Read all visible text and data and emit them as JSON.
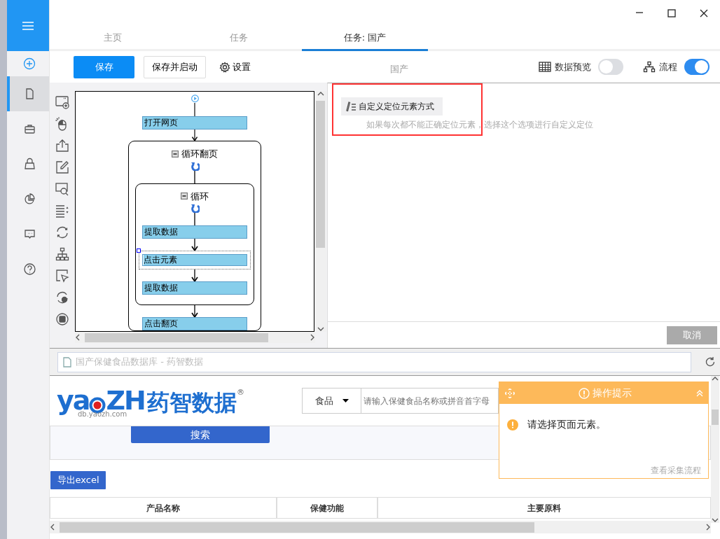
{
  "sidebar": {
    "items": [
      {
        "kind": "add",
        "selected": false
      },
      {
        "kind": "document",
        "selected": true
      },
      {
        "kind": "briefcase",
        "selected": false
      },
      {
        "kind": "lock",
        "selected": false
      },
      {
        "kind": "pie",
        "selected": false
      },
      {
        "kind": "chat",
        "selected": false
      },
      {
        "kind": "help",
        "selected": false
      }
    ]
  },
  "tabs": [
    {
      "label": "主页",
      "selected": false
    },
    {
      "label": "任务",
      "selected": false
    },
    {
      "label": "任务: 国产",
      "selected": true
    }
  ],
  "toolbar": {
    "save": "保存",
    "save_and_start": "保存并启动",
    "settings": "设置",
    "task_name": "国产",
    "toggles": [
      {
        "kind": "table",
        "label": "数据预览",
        "on": false
      },
      {
        "kind": "flow",
        "label": "流程",
        "on": true
      }
    ]
  },
  "workflow": {
    "nodes": [
      {
        "kind": "start"
      },
      {
        "kind": "step",
        "label": "打开网页",
        "selected": false
      },
      {
        "kind": "loop",
        "label": "循环翻页",
        "expanded": true,
        "children": [
          {
            "kind": "loop",
            "label": "循环",
            "expanded": true,
            "children": [
              {
                "kind": "step",
                "label": "提取数据",
                "selected": false
              },
              {
                "kind": "step",
                "label": "点击元素",
                "selected": true
              },
              {
                "kind": "step",
                "label": "提取数据",
                "selected": false
              }
            ]
          },
          {
            "kind": "step",
            "label": "点击翻页",
            "selected": false
          }
        ]
      }
    ]
  },
  "options": [
    {
      "label": "自定义定位元素方式",
      "description": "如果每次都不能正确定位元素，选择这个选项进行自定义定位",
      "highlighted": true
    }
  ],
  "cancel_button": "取消",
  "browser": {
    "address": "国产保健食品数据库 - 药智数据",
    "site": {
      "logo_prefix": "ya",
      "logo_suffix": "ZH",
      "logo_domain": "db.yaozh.com",
      "logo_text": "药智数据",
      "logo_mark": "®",
      "category": "食品",
      "search_placeholder": "请输入保健食品名称或拼音首字母",
      "search_button": "搜索",
      "export_button": "导出excel",
      "table": {
        "columns": [
          "产品名称",
          "保健功能",
          "主要原料"
        ]
      }
    }
  },
  "popup": {
    "title": "操作提示",
    "message": "请选择页面元素。",
    "link": "查看采集流程"
  }
}
